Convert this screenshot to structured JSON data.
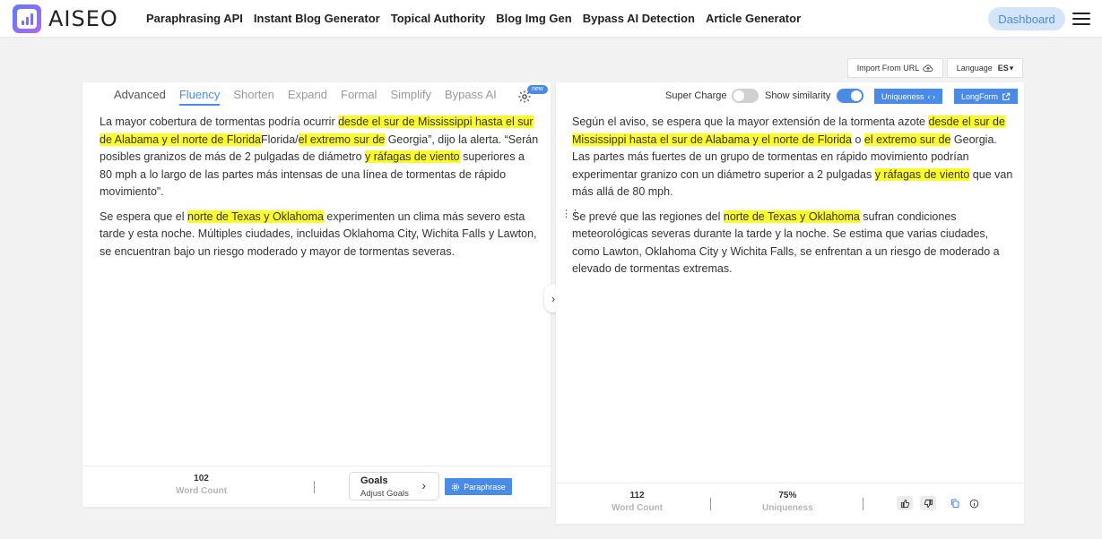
{
  "header": {
    "logo_text": "AISEO",
    "nav": [
      "Paraphrasing API",
      "Instant Blog Generator",
      "Topical Authority",
      "Blog Img Gen",
      "Bypass AI Detection",
      "Article Generator"
    ],
    "dashboard_label": "Dashboard"
  },
  "toolbar": {
    "import_label": "Import From URL",
    "language_label": "Language",
    "language_value": "ES"
  },
  "left": {
    "tabs": [
      "Advanced",
      "Fluency",
      "Shorten",
      "Expand",
      "Formal",
      "Simplify",
      "Bypass AI"
    ],
    "active_tab": "Fluency",
    "new_badge": "new",
    "word_count": "102",
    "word_count_label": "Word Count",
    "goals_title": "Goals",
    "goals_sub": "Adjust Goals",
    "paraphrase_label": "Paraphrase"
  },
  "right": {
    "super_charge_label": "Super Charge",
    "show_similarity_label": "Show similarity",
    "uniqueness_btn": "Uniqueness",
    "longform_btn": "LongForm",
    "word_count": "112",
    "word_count_label": "Word Count",
    "uniqueness_value": "75%",
    "uniqueness_label": "Uniqueness"
  },
  "colors": {
    "accent": "#4a8be8",
    "highlight": "#fdfc2b"
  }
}
